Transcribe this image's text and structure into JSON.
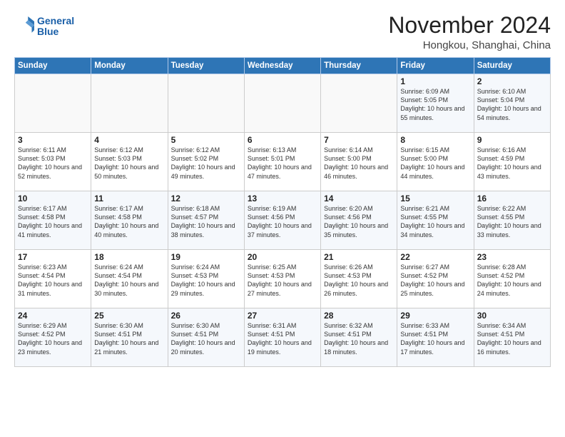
{
  "header": {
    "logo_line1": "General",
    "logo_line2": "Blue",
    "month": "November 2024",
    "location": "Hongkou, Shanghai, China"
  },
  "weekdays": [
    "Sunday",
    "Monday",
    "Tuesday",
    "Wednesday",
    "Thursday",
    "Friday",
    "Saturday"
  ],
  "weeks": [
    [
      {
        "day": "",
        "info": ""
      },
      {
        "day": "",
        "info": ""
      },
      {
        "day": "",
        "info": ""
      },
      {
        "day": "",
        "info": ""
      },
      {
        "day": "",
        "info": ""
      },
      {
        "day": "1",
        "info": "Sunrise: 6:09 AM\nSunset: 5:05 PM\nDaylight: 10 hours\nand 55 minutes."
      },
      {
        "day": "2",
        "info": "Sunrise: 6:10 AM\nSunset: 5:04 PM\nDaylight: 10 hours\nand 54 minutes."
      }
    ],
    [
      {
        "day": "3",
        "info": "Sunrise: 6:11 AM\nSunset: 5:03 PM\nDaylight: 10 hours\nand 52 minutes."
      },
      {
        "day": "4",
        "info": "Sunrise: 6:12 AM\nSunset: 5:03 PM\nDaylight: 10 hours\nand 50 minutes."
      },
      {
        "day": "5",
        "info": "Sunrise: 6:12 AM\nSunset: 5:02 PM\nDaylight: 10 hours\nand 49 minutes."
      },
      {
        "day": "6",
        "info": "Sunrise: 6:13 AM\nSunset: 5:01 PM\nDaylight: 10 hours\nand 47 minutes."
      },
      {
        "day": "7",
        "info": "Sunrise: 6:14 AM\nSunset: 5:00 PM\nDaylight: 10 hours\nand 46 minutes."
      },
      {
        "day": "8",
        "info": "Sunrise: 6:15 AM\nSunset: 5:00 PM\nDaylight: 10 hours\nand 44 minutes."
      },
      {
        "day": "9",
        "info": "Sunrise: 6:16 AM\nSunset: 4:59 PM\nDaylight: 10 hours\nand 43 minutes."
      }
    ],
    [
      {
        "day": "10",
        "info": "Sunrise: 6:17 AM\nSunset: 4:58 PM\nDaylight: 10 hours\nand 41 minutes."
      },
      {
        "day": "11",
        "info": "Sunrise: 6:17 AM\nSunset: 4:58 PM\nDaylight: 10 hours\nand 40 minutes."
      },
      {
        "day": "12",
        "info": "Sunrise: 6:18 AM\nSunset: 4:57 PM\nDaylight: 10 hours\nand 38 minutes."
      },
      {
        "day": "13",
        "info": "Sunrise: 6:19 AM\nSunset: 4:56 PM\nDaylight: 10 hours\nand 37 minutes."
      },
      {
        "day": "14",
        "info": "Sunrise: 6:20 AM\nSunset: 4:56 PM\nDaylight: 10 hours\nand 35 minutes."
      },
      {
        "day": "15",
        "info": "Sunrise: 6:21 AM\nSunset: 4:55 PM\nDaylight: 10 hours\nand 34 minutes."
      },
      {
        "day": "16",
        "info": "Sunrise: 6:22 AM\nSunset: 4:55 PM\nDaylight: 10 hours\nand 33 minutes."
      }
    ],
    [
      {
        "day": "17",
        "info": "Sunrise: 6:23 AM\nSunset: 4:54 PM\nDaylight: 10 hours\nand 31 minutes."
      },
      {
        "day": "18",
        "info": "Sunrise: 6:24 AM\nSunset: 4:54 PM\nDaylight: 10 hours\nand 30 minutes."
      },
      {
        "day": "19",
        "info": "Sunrise: 6:24 AM\nSunset: 4:53 PM\nDaylight: 10 hours\nand 29 minutes."
      },
      {
        "day": "20",
        "info": "Sunrise: 6:25 AM\nSunset: 4:53 PM\nDaylight: 10 hours\nand 27 minutes."
      },
      {
        "day": "21",
        "info": "Sunrise: 6:26 AM\nSunset: 4:53 PM\nDaylight: 10 hours\nand 26 minutes."
      },
      {
        "day": "22",
        "info": "Sunrise: 6:27 AM\nSunset: 4:52 PM\nDaylight: 10 hours\nand 25 minutes."
      },
      {
        "day": "23",
        "info": "Sunrise: 6:28 AM\nSunset: 4:52 PM\nDaylight: 10 hours\nand 24 minutes."
      }
    ],
    [
      {
        "day": "24",
        "info": "Sunrise: 6:29 AM\nSunset: 4:52 PM\nDaylight: 10 hours\nand 23 minutes."
      },
      {
        "day": "25",
        "info": "Sunrise: 6:30 AM\nSunset: 4:51 PM\nDaylight: 10 hours\nand 21 minutes."
      },
      {
        "day": "26",
        "info": "Sunrise: 6:30 AM\nSunset: 4:51 PM\nDaylight: 10 hours\nand 20 minutes."
      },
      {
        "day": "27",
        "info": "Sunrise: 6:31 AM\nSunset: 4:51 PM\nDaylight: 10 hours\nand 19 minutes."
      },
      {
        "day": "28",
        "info": "Sunrise: 6:32 AM\nSunset: 4:51 PM\nDaylight: 10 hours\nand 18 minutes."
      },
      {
        "day": "29",
        "info": "Sunrise: 6:33 AM\nSunset: 4:51 PM\nDaylight: 10 hours\nand 17 minutes."
      },
      {
        "day": "30",
        "info": "Sunrise: 6:34 AM\nSunset: 4:51 PM\nDaylight: 10 hours\nand 16 minutes."
      }
    ]
  ]
}
